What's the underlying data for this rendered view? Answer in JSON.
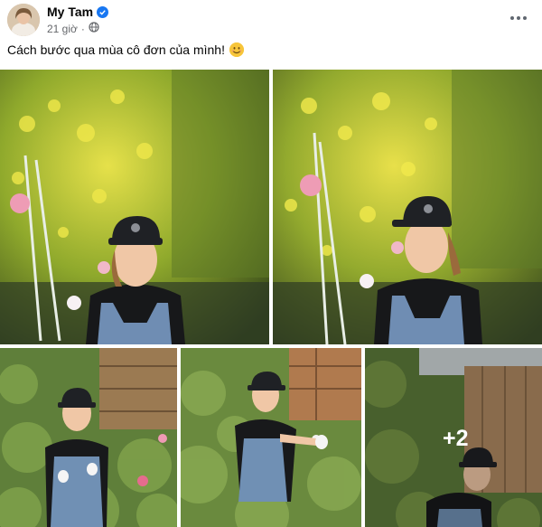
{
  "post": {
    "author": "My Tam",
    "verified": true,
    "timestamp": "21 giờ",
    "audience_icon": "globe-icon",
    "caption": "Cách bước qua mùa cô đơn của mình!",
    "caption_emoji": "smiling-face-emoji",
    "more_options_icon": "more-horizontal-icon"
  },
  "photos": {
    "count_visible": 5,
    "more_count": "+2"
  },
  "colors": {
    "verified_badge": "#1877f2",
    "meta_text": "#65676b",
    "foliage_yellow": "#d8d23a",
    "overalls_blue": "#6f8db3"
  }
}
